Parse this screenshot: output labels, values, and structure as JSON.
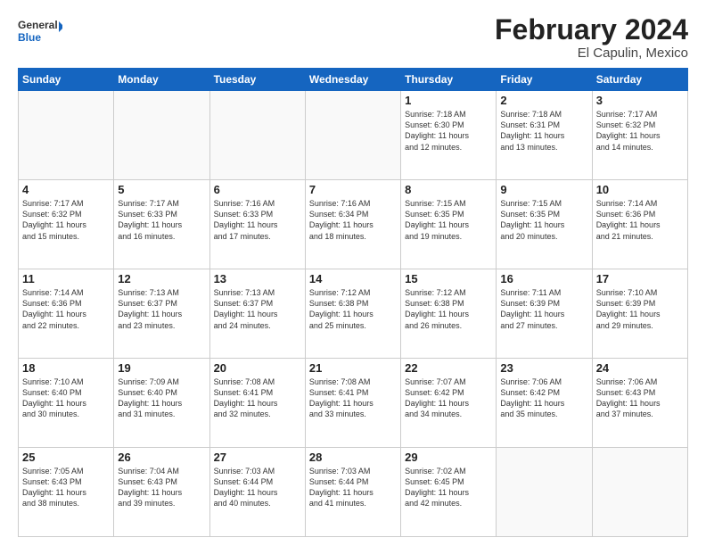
{
  "logo": {
    "line1": "General",
    "line2": "Blue"
  },
  "title": "February 2024",
  "subtitle": "El Capulin, Mexico",
  "headers": [
    "Sunday",
    "Monday",
    "Tuesday",
    "Wednesday",
    "Thursday",
    "Friday",
    "Saturday"
  ],
  "weeks": [
    [
      {
        "day": "",
        "info": ""
      },
      {
        "day": "",
        "info": ""
      },
      {
        "day": "",
        "info": ""
      },
      {
        "day": "",
        "info": ""
      },
      {
        "day": "1",
        "info": "Sunrise: 7:18 AM\nSunset: 6:30 PM\nDaylight: 11 hours\nand 12 minutes."
      },
      {
        "day": "2",
        "info": "Sunrise: 7:18 AM\nSunset: 6:31 PM\nDaylight: 11 hours\nand 13 minutes."
      },
      {
        "day": "3",
        "info": "Sunrise: 7:17 AM\nSunset: 6:32 PM\nDaylight: 11 hours\nand 14 minutes."
      }
    ],
    [
      {
        "day": "4",
        "info": "Sunrise: 7:17 AM\nSunset: 6:32 PM\nDaylight: 11 hours\nand 15 minutes."
      },
      {
        "day": "5",
        "info": "Sunrise: 7:17 AM\nSunset: 6:33 PM\nDaylight: 11 hours\nand 16 minutes."
      },
      {
        "day": "6",
        "info": "Sunrise: 7:16 AM\nSunset: 6:33 PM\nDaylight: 11 hours\nand 17 minutes."
      },
      {
        "day": "7",
        "info": "Sunrise: 7:16 AM\nSunset: 6:34 PM\nDaylight: 11 hours\nand 18 minutes."
      },
      {
        "day": "8",
        "info": "Sunrise: 7:15 AM\nSunset: 6:35 PM\nDaylight: 11 hours\nand 19 minutes."
      },
      {
        "day": "9",
        "info": "Sunrise: 7:15 AM\nSunset: 6:35 PM\nDaylight: 11 hours\nand 20 minutes."
      },
      {
        "day": "10",
        "info": "Sunrise: 7:14 AM\nSunset: 6:36 PM\nDaylight: 11 hours\nand 21 minutes."
      }
    ],
    [
      {
        "day": "11",
        "info": "Sunrise: 7:14 AM\nSunset: 6:36 PM\nDaylight: 11 hours\nand 22 minutes."
      },
      {
        "day": "12",
        "info": "Sunrise: 7:13 AM\nSunset: 6:37 PM\nDaylight: 11 hours\nand 23 minutes."
      },
      {
        "day": "13",
        "info": "Sunrise: 7:13 AM\nSunset: 6:37 PM\nDaylight: 11 hours\nand 24 minutes."
      },
      {
        "day": "14",
        "info": "Sunrise: 7:12 AM\nSunset: 6:38 PM\nDaylight: 11 hours\nand 25 minutes."
      },
      {
        "day": "15",
        "info": "Sunrise: 7:12 AM\nSunset: 6:38 PM\nDaylight: 11 hours\nand 26 minutes."
      },
      {
        "day": "16",
        "info": "Sunrise: 7:11 AM\nSunset: 6:39 PM\nDaylight: 11 hours\nand 27 minutes."
      },
      {
        "day": "17",
        "info": "Sunrise: 7:10 AM\nSunset: 6:39 PM\nDaylight: 11 hours\nand 29 minutes."
      }
    ],
    [
      {
        "day": "18",
        "info": "Sunrise: 7:10 AM\nSunset: 6:40 PM\nDaylight: 11 hours\nand 30 minutes."
      },
      {
        "day": "19",
        "info": "Sunrise: 7:09 AM\nSunset: 6:40 PM\nDaylight: 11 hours\nand 31 minutes."
      },
      {
        "day": "20",
        "info": "Sunrise: 7:08 AM\nSunset: 6:41 PM\nDaylight: 11 hours\nand 32 minutes."
      },
      {
        "day": "21",
        "info": "Sunrise: 7:08 AM\nSunset: 6:41 PM\nDaylight: 11 hours\nand 33 minutes."
      },
      {
        "day": "22",
        "info": "Sunrise: 7:07 AM\nSunset: 6:42 PM\nDaylight: 11 hours\nand 34 minutes."
      },
      {
        "day": "23",
        "info": "Sunrise: 7:06 AM\nSunset: 6:42 PM\nDaylight: 11 hours\nand 35 minutes."
      },
      {
        "day": "24",
        "info": "Sunrise: 7:06 AM\nSunset: 6:43 PM\nDaylight: 11 hours\nand 37 minutes."
      }
    ],
    [
      {
        "day": "25",
        "info": "Sunrise: 7:05 AM\nSunset: 6:43 PM\nDaylight: 11 hours\nand 38 minutes."
      },
      {
        "day": "26",
        "info": "Sunrise: 7:04 AM\nSunset: 6:43 PM\nDaylight: 11 hours\nand 39 minutes."
      },
      {
        "day": "27",
        "info": "Sunrise: 7:03 AM\nSunset: 6:44 PM\nDaylight: 11 hours\nand 40 minutes."
      },
      {
        "day": "28",
        "info": "Sunrise: 7:03 AM\nSunset: 6:44 PM\nDaylight: 11 hours\nand 41 minutes."
      },
      {
        "day": "29",
        "info": "Sunrise: 7:02 AM\nSunset: 6:45 PM\nDaylight: 11 hours\nand 42 minutes."
      },
      {
        "day": "",
        "info": ""
      },
      {
        "day": "",
        "info": ""
      }
    ]
  ]
}
